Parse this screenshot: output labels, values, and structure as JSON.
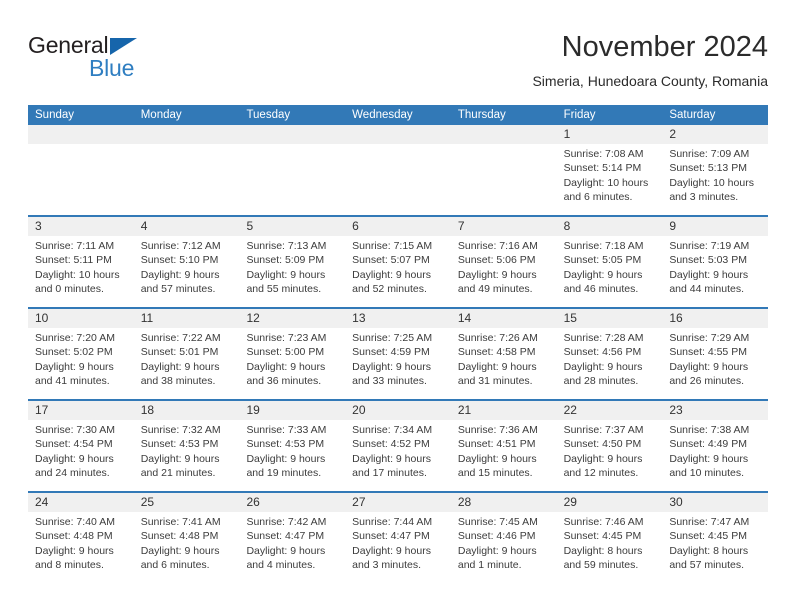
{
  "brand": {
    "name_part1": "General",
    "name_part2": "Blue",
    "triangle_color": "#1665ab",
    "blue_color": "#2f7ec1"
  },
  "header": {
    "month_title": "November 2024",
    "location": "Simeria, Hunedoara County, Romania"
  },
  "theme": {
    "header_blue": "#3279b7",
    "daynum_band": "#f0f0f0",
    "text": "#3c3c3c"
  },
  "weekdays": [
    "Sunday",
    "Monday",
    "Tuesday",
    "Wednesday",
    "Thursday",
    "Friday",
    "Saturday"
  ],
  "weeks": [
    [
      {
        "day": "",
        "sunrise": "",
        "sunset": "",
        "daylight": ""
      },
      {
        "day": "",
        "sunrise": "",
        "sunset": "",
        "daylight": ""
      },
      {
        "day": "",
        "sunrise": "",
        "sunset": "",
        "daylight": ""
      },
      {
        "day": "",
        "sunrise": "",
        "sunset": "",
        "daylight": ""
      },
      {
        "day": "",
        "sunrise": "",
        "sunset": "",
        "daylight": ""
      },
      {
        "day": "1",
        "sunrise": "Sunrise: 7:08 AM",
        "sunset": "Sunset: 5:14 PM",
        "daylight": "Daylight: 10 hours and 6 minutes."
      },
      {
        "day": "2",
        "sunrise": "Sunrise: 7:09 AM",
        "sunset": "Sunset: 5:13 PM",
        "daylight": "Daylight: 10 hours and 3 minutes."
      }
    ],
    [
      {
        "day": "3",
        "sunrise": "Sunrise: 7:11 AM",
        "sunset": "Sunset: 5:11 PM",
        "daylight": "Daylight: 10 hours and 0 minutes."
      },
      {
        "day": "4",
        "sunrise": "Sunrise: 7:12 AM",
        "sunset": "Sunset: 5:10 PM",
        "daylight": "Daylight: 9 hours and 57 minutes."
      },
      {
        "day": "5",
        "sunrise": "Sunrise: 7:13 AM",
        "sunset": "Sunset: 5:09 PM",
        "daylight": "Daylight: 9 hours and 55 minutes."
      },
      {
        "day": "6",
        "sunrise": "Sunrise: 7:15 AM",
        "sunset": "Sunset: 5:07 PM",
        "daylight": "Daylight: 9 hours and 52 minutes."
      },
      {
        "day": "7",
        "sunrise": "Sunrise: 7:16 AM",
        "sunset": "Sunset: 5:06 PM",
        "daylight": "Daylight: 9 hours and 49 minutes."
      },
      {
        "day": "8",
        "sunrise": "Sunrise: 7:18 AM",
        "sunset": "Sunset: 5:05 PM",
        "daylight": "Daylight: 9 hours and 46 minutes."
      },
      {
        "day": "9",
        "sunrise": "Sunrise: 7:19 AM",
        "sunset": "Sunset: 5:03 PM",
        "daylight": "Daylight: 9 hours and 44 minutes."
      }
    ],
    [
      {
        "day": "10",
        "sunrise": "Sunrise: 7:20 AM",
        "sunset": "Sunset: 5:02 PM",
        "daylight": "Daylight: 9 hours and 41 minutes."
      },
      {
        "day": "11",
        "sunrise": "Sunrise: 7:22 AM",
        "sunset": "Sunset: 5:01 PM",
        "daylight": "Daylight: 9 hours and 38 minutes."
      },
      {
        "day": "12",
        "sunrise": "Sunrise: 7:23 AM",
        "sunset": "Sunset: 5:00 PM",
        "daylight": "Daylight: 9 hours and 36 minutes."
      },
      {
        "day": "13",
        "sunrise": "Sunrise: 7:25 AM",
        "sunset": "Sunset: 4:59 PM",
        "daylight": "Daylight: 9 hours and 33 minutes."
      },
      {
        "day": "14",
        "sunrise": "Sunrise: 7:26 AM",
        "sunset": "Sunset: 4:58 PM",
        "daylight": "Daylight: 9 hours and 31 minutes."
      },
      {
        "day": "15",
        "sunrise": "Sunrise: 7:28 AM",
        "sunset": "Sunset: 4:56 PM",
        "daylight": "Daylight: 9 hours and 28 minutes."
      },
      {
        "day": "16",
        "sunrise": "Sunrise: 7:29 AM",
        "sunset": "Sunset: 4:55 PM",
        "daylight": "Daylight: 9 hours and 26 minutes."
      }
    ],
    [
      {
        "day": "17",
        "sunrise": "Sunrise: 7:30 AM",
        "sunset": "Sunset: 4:54 PM",
        "daylight": "Daylight: 9 hours and 24 minutes."
      },
      {
        "day": "18",
        "sunrise": "Sunrise: 7:32 AM",
        "sunset": "Sunset: 4:53 PM",
        "daylight": "Daylight: 9 hours and 21 minutes."
      },
      {
        "day": "19",
        "sunrise": "Sunrise: 7:33 AM",
        "sunset": "Sunset: 4:53 PM",
        "daylight": "Daylight: 9 hours and 19 minutes."
      },
      {
        "day": "20",
        "sunrise": "Sunrise: 7:34 AM",
        "sunset": "Sunset: 4:52 PM",
        "daylight": "Daylight: 9 hours and 17 minutes."
      },
      {
        "day": "21",
        "sunrise": "Sunrise: 7:36 AM",
        "sunset": "Sunset: 4:51 PM",
        "daylight": "Daylight: 9 hours and 15 minutes."
      },
      {
        "day": "22",
        "sunrise": "Sunrise: 7:37 AM",
        "sunset": "Sunset: 4:50 PM",
        "daylight": "Daylight: 9 hours and 12 minutes."
      },
      {
        "day": "23",
        "sunrise": "Sunrise: 7:38 AM",
        "sunset": "Sunset: 4:49 PM",
        "daylight": "Daylight: 9 hours and 10 minutes."
      }
    ],
    [
      {
        "day": "24",
        "sunrise": "Sunrise: 7:40 AM",
        "sunset": "Sunset: 4:48 PM",
        "daylight": "Daylight: 9 hours and 8 minutes."
      },
      {
        "day": "25",
        "sunrise": "Sunrise: 7:41 AM",
        "sunset": "Sunset: 4:48 PM",
        "daylight": "Daylight: 9 hours and 6 minutes."
      },
      {
        "day": "26",
        "sunrise": "Sunrise: 7:42 AM",
        "sunset": "Sunset: 4:47 PM",
        "daylight": "Daylight: 9 hours and 4 minutes."
      },
      {
        "day": "27",
        "sunrise": "Sunrise: 7:44 AM",
        "sunset": "Sunset: 4:47 PM",
        "daylight": "Daylight: 9 hours and 3 minutes."
      },
      {
        "day": "28",
        "sunrise": "Sunrise: 7:45 AM",
        "sunset": "Sunset: 4:46 PM",
        "daylight": "Daylight: 9 hours and 1 minute."
      },
      {
        "day": "29",
        "sunrise": "Sunrise: 7:46 AM",
        "sunset": "Sunset: 4:45 PM",
        "daylight": "Daylight: 8 hours and 59 minutes."
      },
      {
        "day": "30",
        "sunrise": "Sunrise: 7:47 AM",
        "sunset": "Sunset: 4:45 PM",
        "daylight": "Daylight: 8 hours and 57 minutes."
      }
    ]
  ]
}
